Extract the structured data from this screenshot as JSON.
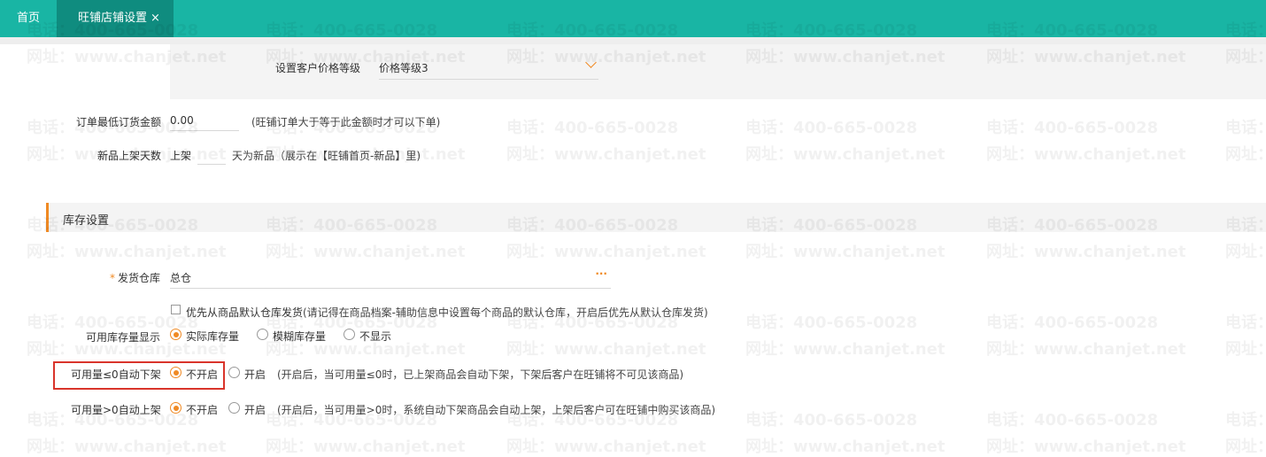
{
  "tabs": {
    "home": "首页",
    "active": "旺铺店铺设置",
    "close_glyph": "×"
  },
  "watermark": {
    "phone": "电话：400-665-0028",
    "site": "网址：www.chanjet.net"
  },
  "price_level": {
    "label": "设置客户价格等级",
    "value": "价格等级3"
  },
  "min_order": {
    "label": "订单最低订货金额",
    "value": "0.00",
    "hint": "(旺铺订单大于等于此金额时才可以下单)"
  },
  "new_days": {
    "label": "新品上架天数",
    "prefix": "上架",
    "value": "",
    "suffix": "天为新品（展示在【旺铺首页-新品】里)"
  },
  "inventory_section": {
    "title": "库存设置"
  },
  "warehouse": {
    "required_mark": "*",
    "label": "发货仓库",
    "value": "总仓",
    "more_glyph": "···"
  },
  "default_warehouse": {
    "checked": false,
    "label": "优先从商品默认仓库发货",
    "hint": "(请记得在商品档案-辅助信息中设置每个商品的默认仓库，开启后优先从默认仓库发货)"
  },
  "stock_display": {
    "label": "可用库存量显示",
    "options": [
      "实际库存量",
      "模糊库存量",
      "不显示"
    ],
    "selected": 0
  },
  "auto_delist": {
    "label": "可用量≤0自动下架",
    "options": [
      "不开启",
      "开启"
    ],
    "selected": 0,
    "hint": "(开启后，当可用量≤0时，已上架商品会自动下架，下架后客户在旺铺将不可见该商品)"
  },
  "auto_list": {
    "label": "可用量>0自动上架",
    "options": [
      "不开启",
      "开启"
    ],
    "selected": 0,
    "hint": "(开启后，当可用量>0时，系统自动下架商品会自动上架，上架后客户可在旺铺中购买该商品)"
  },
  "colors": {
    "topbar": "#19b5a4",
    "active_tab": "#0f8c7f",
    "accent": "#f08a24",
    "highlight": "#d9342b"
  }
}
